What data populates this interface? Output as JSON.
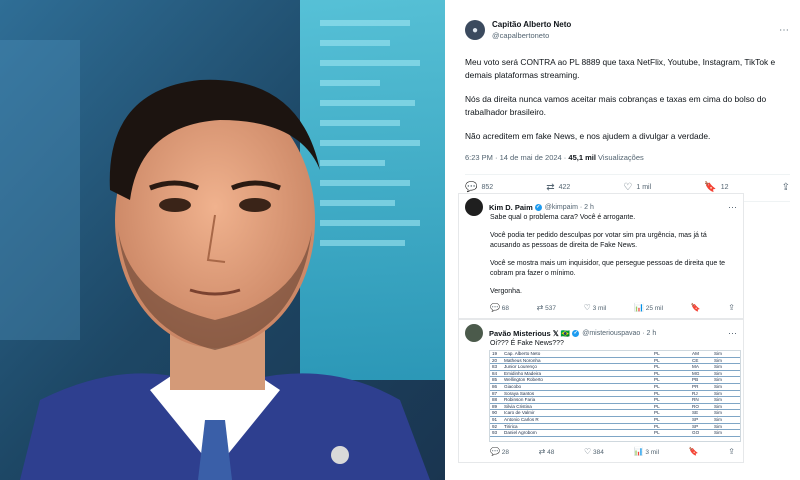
{
  "main_tweet": {
    "display_name": "Capitão Alberto Neto",
    "handle": "@capalbertoneto",
    "paragraphs": [
      "Meu voto será CONTRA ao PL 8889 que taxa NetFlix, Youtube, Instagram, TikTok e demais plataformas streaming.",
      "Nós da direita nunca vamos aceitar mais cobranças e taxas em cima do bolso do trabalhador brasileiro.",
      "Não acreditem em fake News, e nos ajudem a divulgar a verdade."
    ],
    "timestamp": "6:23 PM · 14 de mai de 2024 ·",
    "views_count": "45,1 mil",
    "views_label": "Visualizações",
    "replies": "852",
    "retweets": "422",
    "likes": "1 mil",
    "bookmarks": "12"
  },
  "reply1": {
    "display_name": "Kim D. Paim",
    "handle": "@kimpaim · 2 h",
    "paragraphs": [
      "Sabe qual o problema cara? Você é arrogante.",
      "Você podia ter pedido desculpas por votar sim pra urgência, mas já tá acusando as pessoas de direita de Fake News.",
      "Você se mostra mais um inquisidor, que persegue pessoas de direita que te cobram pra fazer o mínimo.",
      "Vergonha."
    ],
    "replies": "68",
    "retweets": "537",
    "likes": "3 mil",
    "views": "25 mil"
  },
  "reply2": {
    "display_name": "Pavão Misterious 𝕏 🇧🇷",
    "handle": "@misteriouspavao · 2 h",
    "text": "Oi??? É Fake News???",
    "replies": "28",
    "retweets": "48",
    "likes": "384",
    "views": "3 mil",
    "vote_rows": [
      [
        "19",
        "Cap. Alberto Neto",
        "PL",
        "AM",
        "Sim"
      ],
      [
        "20",
        "Matheus Noronha",
        "PL",
        "CE",
        "Sim"
      ],
      [
        "83",
        "Junior Lourenço",
        "PL",
        "MA",
        "Sim"
      ],
      [
        "84",
        "Emidinho Madeira",
        "PL",
        "MG",
        "Sim"
      ],
      [
        "85",
        "Wellington Roberto",
        "PL",
        "PB",
        "Sim"
      ],
      [
        "86",
        "Giacobo",
        "PL",
        "PR",
        "Sim"
      ],
      [
        "87",
        "Soraya Santos",
        "PL",
        "RJ",
        "Sim"
      ],
      [
        "88",
        "Robinson Faria",
        "PL",
        "RN",
        "Sim"
      ],
      [
        "89",
        "Silvia Cristina",
        "PL",
        "RO",
        "Sim"
      ],
      [
        "90",
        "Icaro de Valmir",
        "PL",
        "SE",
        "Sim"
      ],
      [
        "91",
        "Antonio Carlos R",
        "PL",
        "SP",
        "Sim"
      ],
      [
        "92",
        "Tiririca",
        "PL",
        "SP",
        "Sim"
      ],
      [
        "93",
        "Daniel Agrobom",
        "PL",
        "GO",
        "Sim"
      ]
    ]
  },
  "icons": {
    "more": "⋯",
    "reply": "💬",
    "retweet": "⇄",
    "like": "♡",
    "bookmark": "🔖",
    "views": "📊",
    "share": "⇪"
  }
}
